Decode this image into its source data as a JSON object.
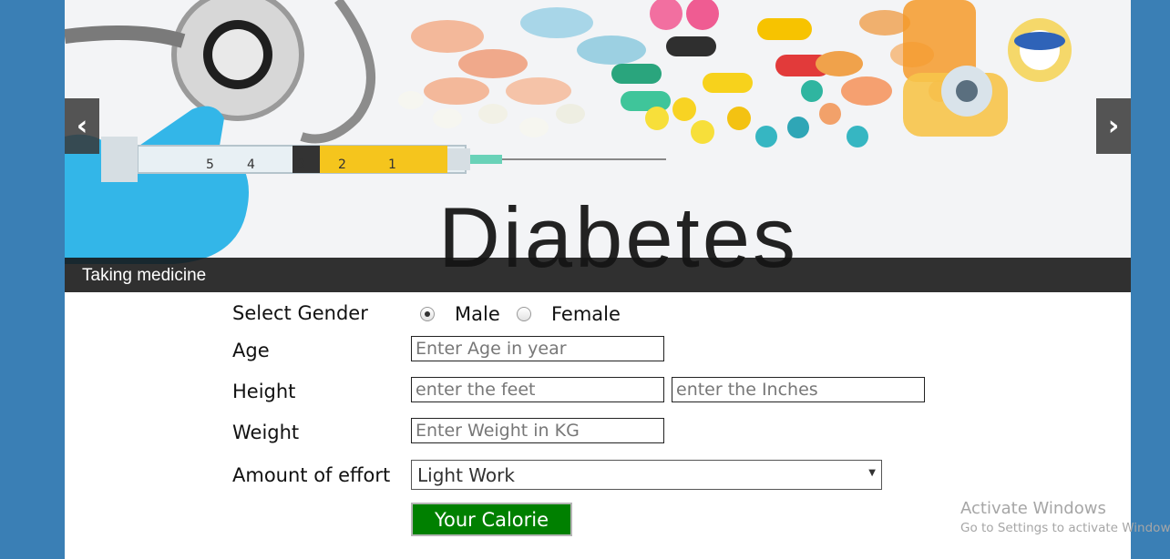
{
  "slider": {
    "caption": "Taking medicine",
    "headline": "Diabetes",
    "prev_icon": "chevron-left-icon",
    "next_icon": "chevron-right-icon",
    "prev_glyph": "‹",
    "next_glyph": "›"
  },
  "form": {
    "gender": {
      "label": "Select Gender",
      "options": [
        "Male",
        "Female"
      ],
      "selected": "Male"
    },
    "age": {
      "label": "Age",
      "placeholder": "Enter Age in year"
    },
    "height": {
      "label": "Height",
      "feet_placeholder": "enter the feet",
      "inches_placeholder": "enter the Inches"
    },
    "weight": {
      "label": "Weight",
      "placeholder": "Enter Weight in KG"
    },
    "effort": {
      "label": "Amount of effort",
      "selected": "Light Work"
    },
    "submit_label": "Your Calorie"
  },
  "watermark": {
    "title": "Activate Windows",
    "subtitle": "Go to Settings to activate Windows."
  },
  "colors": {
    "background": "#3a7fb5",
    "submit_button": "#008000",
    "caption_bar": "#141414"
  }
}
